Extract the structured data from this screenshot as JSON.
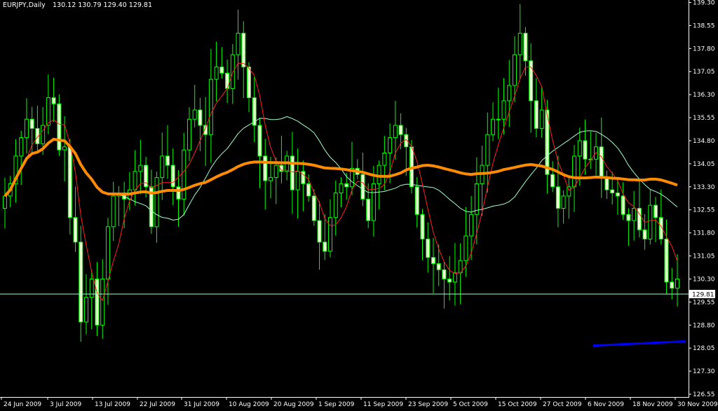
{
  "window": {
    "symbol_label": "EURJPY,Daily",
    "ohlc_label": "130.12 130.79 129.40 129.81"
  },
  "colors": {
    "background": "#000000",
    "axis": "#ffffff",
    "candle": "#00ff00",
    "candle_body_fill": "#e8ffd0",
    "ma_fast": "#ff2020",
    "ma_mid": "#a0ffc8",
    "ma_slow": "#ff8c00",
    "trend_line": "#0000ff",
    "bid_line": "#a0ffc8",
    "price_tag_bg": "#ffffff",
    "price_tag_text": "#000000"
  },
  "chart_data": {
    "type": "candlestick",
    "symbol": "EURJPY",
    "timeframe": "Daily",
    "ylim": [
      126.55,
      139.3
    ],
    "y_ticks": [
      "139.30",
      "138.55",
      "137.80",
      "137.05",
      "136.30",
      "135.55",
      "134.80",
      "134.05",
      "133.30",
      "132.55",
      "131.80",
      "131.05",
      "130.30",
      "129.55",
      "128.80",
      "128.05",
      "127.30",
      "126.55"
    ],
    "x_ticks": [
      "24 Jun 2009",
      "3 Jul 2009",
      "13 Jul 2009",
      "22 Jul 2009",
      "31 Jul 2009",
      "10 Aug 2009",
      "20 Aug 2009",
      "1 Sep 2009",
      "11 Sep 2009",
      "23 Sep 2009",
      "5 Oct 2009",
      "15 Oct 2009",
      "27 Oct 2009",
      "6 Nov 2009",
      "18 Nov 2009",
      "30 Nov 2009"
    ],
    "last_price": "129.81",
    "close": [
      133.0,
      133.4,
      134.3,
      134.9,
      135.5,
      135.2,
      134.7,
      135.3,
      136.2,
      136.0,
      134.5,
      134.6,
      132.3,
      131.5,
      128.9,
      129.7,
      130.3,
      128.8,
      130.3,
      132.0,
      133.0,
      133.1,
      132.9,
      133.2,
      133.8,
      134.0,
      133.3,
      132.0,
      133.6,
      134.3,
      134.0,
      133.3,
      132.9,
      134.5,
      135.5,
      135.8,
      135.3,
      135.0,
      136.8,
      137.2,
      137.0,
      136.5,
      137.6,
      138.3,
      137.2,
      136.2,
      135.3,
      134.3,
      133.5,
      133.6,
      134.0,
      133.8,
      134.3,
      133.2,
      133.8,
      133.4,
      133.0,
      132.2,
      131.5,
      131.2,
      132.3,
      133.1,
      133.4,
      133.3,
      133.9,
      133.7,
      132.9,
      132.2,
      133.4,
      134.0,
      134.4,
      134.9,
      135.3,
      135.0,
      134.6,
      133.3,
      132.4,
      131.6,
      131.0,
      130.8,
      130.6,
      130.3,
      130.2,
      130.5,
      130.9,
      131.7,
      132.4,
      133.4,
      134.0,
      135.0,
      135.5,
      135.5,
      136.1,
      136.6,
      137.6,
      138.3,
      137.4,
      136.1,
      135.2,
      135.8,
      133.7,
      133.3,
      132.6,
      133.0,
      133.3,
      134.3,
      134.8,
      134.2,
      134.2,
      134.6,
      133.6,
      133.2,
      133.1,
      133.0,
      132.4,
      132.2,
      132.6,
      131.9,
      131.6,
      132.7,
      132.3,
      131.6,
      130.2,
      130.0,
      130.3
    ]
  }
}
